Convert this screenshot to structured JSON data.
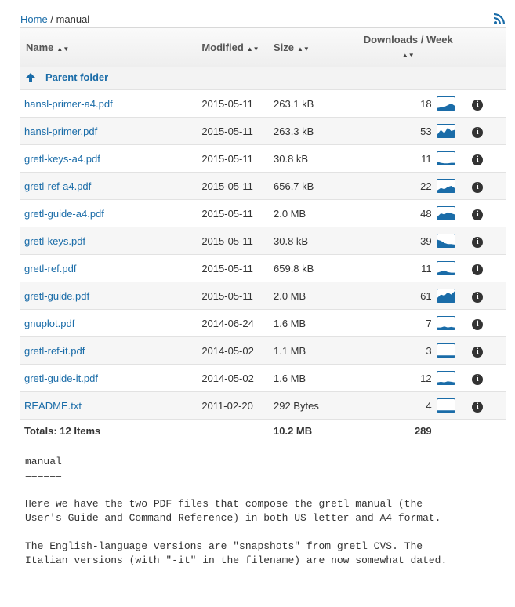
{
  "breadcrumb": {
    "home": "Home",
    "sep": "/",
    "current": "manual"
  },
  "table": {
    "headers": {
      "name": "Name",
      "modified": "Modified",
      "size": "Size",
      "downloads": "Downloads / Week"
    },
    "sort_glyph": "▲▼",
    "parent_label": "Parent folder",
    "rows": [
      {
        "name": "hansl-primer-a4.pdf",
        "modified": "2015-05-11",
        "size": "263.1 kB",
        "downloads": "18",
        "spark": [
          0.1,
          0.15,
          0.2,
          0.35,
          0.5,
          0.3
        ]
      },
      {
        "name": "hansl-primer.pdf",
        "modified": "2015-05-11",
        "size": "263.3 kB",
        "downloads": "53",
        "spark": [
          0.2,
          0.6,
          0.3,
          0.8,
          0.5,
          0.6
        ]
      },
      {
        "name": "gretl-keys-a4.pdf",
        "modified": "2015-05-11",
        "size": "30.8 kB",
        "downloads": "11",
        "spark": [
          0.2,
          0.1,
          0.05,
          0.05,
          0.1,
          0.1
        ]
      },
      {
        "name": "gretl-ref-a4.pdf",
        "modified": "2015-05-11",
        "size": "656.7 kB",
        "downloads": "22",
        "spark": [
          0.1,
          0.3,
          0.2,
          0.4,
          0.5,
          0.3
        ]
      },
      {
        "name": "gretl-guide-a4.pdf",
        "modified": "2015-05-11",
        "size": "2.0 MB",
        "downloads": "48",
        "spark": [
          0.2,
          0.5,
          0.4,
          0.6,
          0.5,
          0.4
        ]
      },
      {
        "name": "gretl-keys.pdf",
        "modified": "2015-05-11",
        "size": "30.8 kB",
        "downloads": "39",
        "spark": [
          0.6,
          0.5,
          0.3,
          0.2,
          0.2,
          0.15
        ]
      },
      {
        "name": "gretl-ref.pdf",
        "modified": "2015-05-11",
        "size": "659.8 kB",
        "downloads": "11",
        "spark": [
          0.1,
          0.2,
          0.3,
          0.15,
          0.1,
          0.1
        ]
      },
      {
        "name": "gretl-guide.pdf",
        "modified": "2015-05-11",
        "size": "2.0 MB",
        "downloads": "61",
        "spark": [
          0.3,
          0.6,
          0.5,
          0.8,
          0.6,
          0.9
        ]
      },
      {
        "name": "gnuplot.pdf",
        "modified": "2014-06-24",
        "size": "1.6 MB",
        "downloads": "7",
        "spark": [
          0.1,
          0.1,
          0.2,
          0.1,
          0.15,
          0.1
        ]
      },
      {
        "name": "gretl-ref-it.pdf",
        "modified": "2014-05-02",
        "size": "1.1 MB",
        "downloads": "3",
        "spark": [
          0.05,
          0.05,
          0.05,
          0.05,
          0.05,
          0.05
        ]
      },
      {
        "name": "gretl-guide-it.pdf",
        "modified": "2014-05-02",
        "size": "1.6 MB",
        "downloads": "12",
        "spark": [
          0.1,
          0.15,
          0.1,
          0.2,
          0.15,
          0.1
        ]
      },
      {
        "name": "README.txt",
        "modified": "2011-02-20",
        "size": "292 Bytes",
        "downloads": "4",
        "spark": [
          0.05,
          0.05,
          0.05,
          0.05,
          0.05,
          0.05
        ]
      }
    ],
    "totals": {
      "label": "Totals: 12 Items",
      "size": "10.2 MB",
      "downloads": "289"
    }
  },
  "readme": {
    "title": "manual",
    "underline": "======",
    "para1_line1": "Here we have the two PDF files that compose the gretl manual (the",
    "para1_line2": "User's Guide and Command Reference) in both US letter and A4 format.",
    "para2_line1": "The English-language versions are \"snapshots\" from gretl CVS. The",
    "para2_line2": "Italian versions (with \"-it\" in the filename) are now somewhat dated."
  },
  "colors": {
    "link": "#1a6ca8",
    "info_icon": "#333333",
    "spark_fill": "#1a6ca8"
  }
}
